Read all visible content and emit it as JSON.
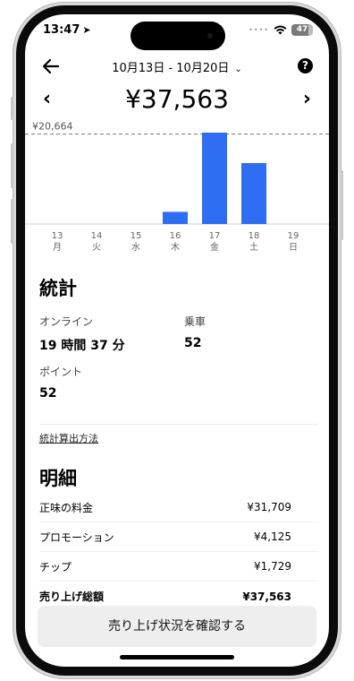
{
  "status_bar": {
    "time": "13:47",
    "battery": "47"
  },
  "header": {
    "date_range": "10月13日 - 10月20日",
    "help_label": "?"
  },
  "summary": {
    "total": "¥37,563",
    "prev_label": "‹",
    "next_label": "›"
  },
  "chart_data": {
    "type": "bar",
    "reference_line_label": "¥20,664",
    "reference_line_value": 20664,
    "categories": [
      "13 月",
      "14 火",
      "15 水",
      "16 木",
      "17 金",
      "18 土",
      "19 日"
    ],
    "days": [
      "13",
      "14",
      "15",
      "16",
      "17",
      "18",
      "19"
    ],
    "weekdays": [
      "月",
      "火",
      "水",
      "木",
      "金",
      "土",
      "日"
    ],
    "values": [
      0,
      0,
      0,
      2800,
      21000,
      14000,
      0
    ],
    "ylim": [
      0,
      21000
    ],
    "bar_color": "#2f6ef2"
  },
  "stats": {
    "title": "統計",
    "online_label": "オンライン",
    "online_value": "19 時間 37 分",
    "rides_label": "乗車",
    "rides_value": "52",
    "points_label": "ポイント",
    "points_value": "52",
    "calc_link": "統計算出方法"
  },
  "details": {
    "title": "明細",
    "rows": [
      {
        "label": "正味の料金",
        "value": "¥31,709"
      },
      {
        "label": "プロモーション",
        "value": "¥4,125"
      },
      {
        "label": "チップ",
        "value": "¥1,729"
      },
      {
        "label": "売り上げ総額",
        "value": "¥37,563"
      }
    ]
  },
  "cta": {
    "label": "売り上げ状況を確認する"
  },
  "colors": {
    "accent": "#2f6ef2",
    "button_bg": "#eeeeee"
  }
}
